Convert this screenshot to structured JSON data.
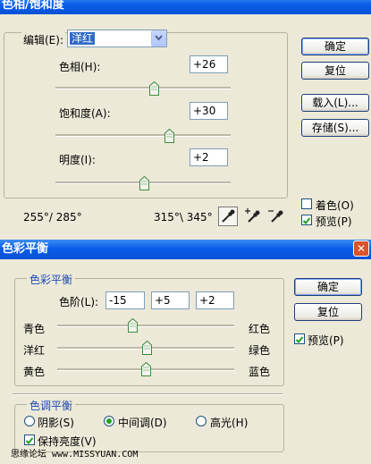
{
  "hue_dialog": {
    "title": "色相/饱和度",
    "edit_label": "编辑(E):",
    "edit_value": "洋红",
    "hue_label": "色相(H):",
    "hue_value": "+26",
    "hue_level": 0.563,
    "saturation_label": "饱和度(A):",
    "saturation_value": "+30",
    "saturation_level": 0.65,
    "lightness_label": "明度(I):",
    "lightness_value": "+2",
    "lightness_level": 0.51,
    "range_left": "255°/ 285°",
    "range_right": "315°\\ 345°",
    "buttons": {
      "ok": "确定",
      "reset": "复位",
      "load": "载入(L)...",
      "save": "存储(S)..."
    },
    "colorize_label": "着色(O)",
    "colorize_checked": false,
    "preview_label": "预览(P)",
    "preview_checked": true,
    "icons": [
      "eyedropper-icon",
      "eyedropper-plus-icon",
      "eyedropper-minus-icon"
    ]
  },
  "balance_dialog": {
    "title": "色彩平衡",
    "group_balance": "色彩平衡",
    "levels_label": "色阶(L):",
    "levels": [
      "-15",
      "+5",
      "+2"
    ],
    "sliders": [
      {
        "left": "青色",
        "right": "红色",
        "level": 0.425
      },
      {
        "left": "洋红",
        "right": "绿色",
        "level": 0.51
      },
      {
        "left": "黄色",
        "right": "蓝色",
        "level": 0.505
      }
    ],
    "buttons": {
      "ok": "确定",
      "reset": "复位"
    },
    "preview_label": "预览(P)",
    "preview_checked": true,
    "group_tone": "色调平衡",
    "tone_options": [
      {
        "label": "阴影(S)",
        "selected": false
      },
      {
        "label": "中间调(D)",
        "selected": true
      },
      {
        "label": "高光(H)",
        "selected": false
      }
    ],
    "preserve_label": "保持亮度(V)",
    "preserve_checked": true,
    "close_glyph": "✕"
  },
  "watermark": "思缘论坛  www.MISSYUAN.COM",
  "colors": {
    "titlebar": "#0a5de8",
    "group_text": "#1d49b5",
    "dialog_bg": "#ece9d8"
  }
}
